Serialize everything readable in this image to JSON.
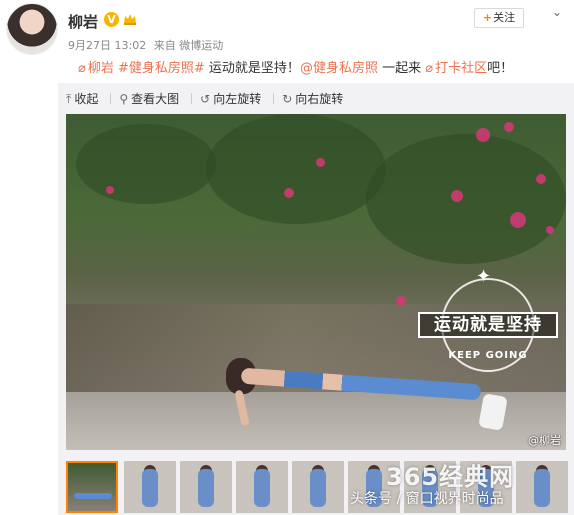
{
  "post": {
    "username": "柳岩",
    "verified_badge": "V",
    "date": "9月27日 13:02",
    "source": "来自 微博运动",
    "follow_label": "关注",
    "more_icon": "chevron-down-icon"
  },
  "content": {
    "tag1": "柳岩",
    "topic1": "#健身私房照#",
    "text1": "运动就是坚持！",
    "topic2": "@健身私房照",
    "text2": "一起来",
    "tag2": "打卡社区",
    "text3": "吧！"
  },
  "toolbar": {
    "collapse": "收起",
    "view_large": "查看大图",
    "rotate_left": "向左旋转",
    "rotate_right": "向右旋转"
  },
  "image": {
    "logo_text": "运动就是坚持",
    "logo_sub": "KEEP GOING",
    "watermark": "@柳岩"
  },
  "overlay": {
    "brand": "365经典网",
    "source": "头条号 / 窗口视界时尚品"
  },
  "colors": {
    "accent": "#eb7350",
    "follow_plus": "#ff8200",
    "badge": "#f7b500"
  }
}
